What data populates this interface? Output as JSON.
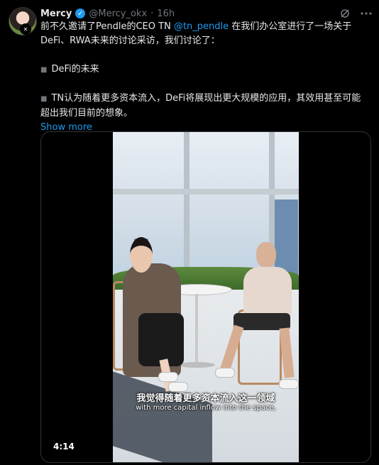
{
  "tweet": {
    "author_name": "Mercy",
    "handle": "@Mercy_okx",
    "separator": "·",
    "time": "16h",
    "text_line1_pre": "前不久邀请了Pendle的CEO TN ",
    "mention": "@tn_pendle",
    "text_line1_post": " 在我们办公室进行了一场关于DeFi、RWA未来的讨论采访，我们讨论了：",
    "bullet1": "DeFi的未来",
    "bullet2": "TN认为随着更多资本流入，DeFi将展现出更大规模的应用，其效用甚至可能超出我们目前的想象。",
    "bullet_glyph": "■",
    "show_more": "Show more"
  },
  "media": {
    "subtitle_cn": "我觉得随着更多资本流入这一领域",
    "subtitle_en": "with more capital inflow into the space,",
    "duration": "4:14"
  },
  "icons": {
    "verified": "verified-badge-icon",
    "grok": "grok-icon",
    "more": "more-options-icon"
  },
  "colors": {
    "background": "#000000",
    "text": "#e7e9ea",
    "muted": "#71767b",
    "accent": "#1d9bf0"
  }
}
